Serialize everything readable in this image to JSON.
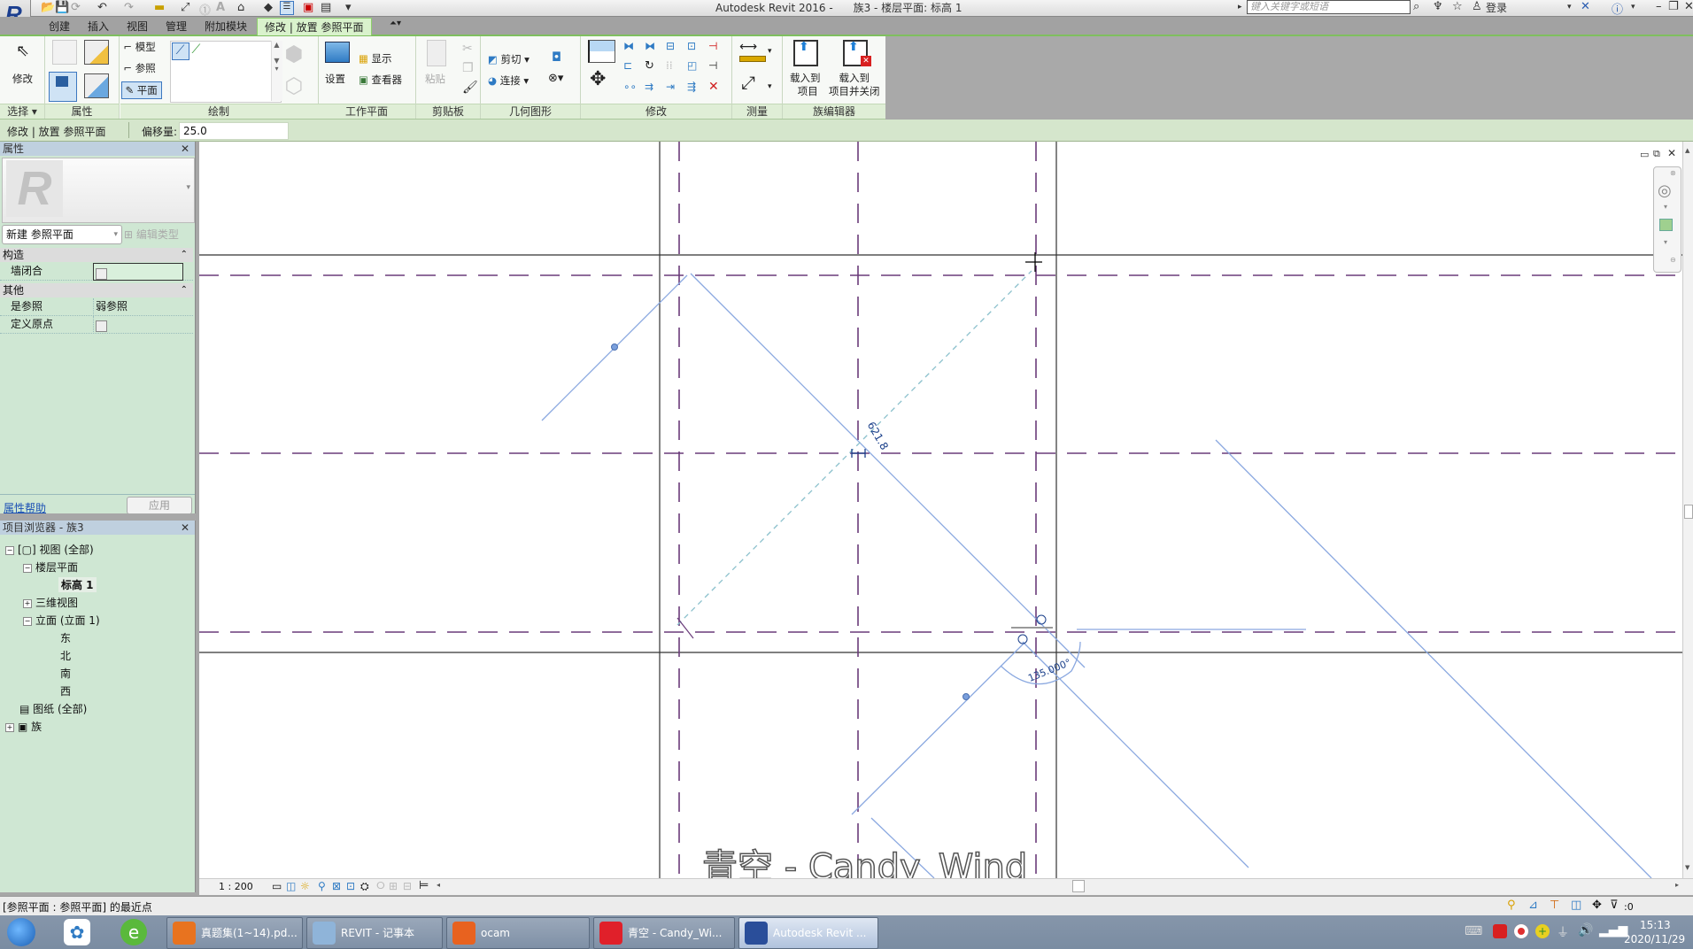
{
  "titlebar": {
    "title": "Autodesk Revit 2016 -      族3 - 楼层平面: 标高 1",
    "search_placeholder": "键入关键字或短语",
    "login": "登录"
  },
  "tabs": [
    {
      "label": "创建"
    },
    {
      "label": "插入"
    },
    {
      "label": "视图"
    },
    {
      "label": "管理"
    },
    {
      "label": "附加模块"
    },
    {
      "label": "修改 | 放置 参照平面",
      "active": true
    }
  ],
  "ribbon": {
    "select": {
      "modify": "修改",
      "label": "选择 ▾"
    },
    "properties": {
      "label": "属性"
    },
    "draw": {
      "model": "模型",
      "reference": "参照",
      "plane": "平面",
      "label": "绘制"
    },
    "workplane": {
      "set": "设置",
      "show": "显示",
      "viewer": "查看器",
      "label": "工作平面"
    },
    "clipboard": {
      "paste": "粘贴",
      "label": "剪贴板"
    },
    "geometry": {
      "cut": "剪切",
      "join": "连接",
      "label": "几何图形"
    },
    "modify": {
      "label": "修改"
    },
    "measure": {
      "label": "测量"
    },
    "family_editor": {
      "load_project": "载入到\n项目",
      "load_project_l1": "载入到",
      "load_project_l2": "项目",
      "load_close_l1": "载入到",
      "load_close_l2": "项目并关闭",
      "label": "族编辑器"
    }
  },
  "options_bar": {
    "context": "修改 | 放置 参照平面",
    "offset_label": "偏移量:",
    "offset_value": "25.0"
  },
  "properties": {
    "title": "属性",
    "type_selector": "新建 参照平面",
    "edit_type": "编辑类型",
    "groups": [
      {
        "name": "构造",
        "rows": [
          {
            "key": "墙闭合",
            "value": "",
            "checkbox": true
          }
        ]
      },
      {
        "name": "其他",
        "rows": [
          {
            "key": "是参照",
            "value": "弱参照"
          },
          {
            "key": "定义原点",
            "value": "",
            "checkbox": true
          }
        ]
      }
    ],
    "help_link": "属性帮助",
    "apply": "应用"
  },
  "browser": {
    "title": "项目浏览器 - 族3",
    "nodes": [
      {
        "label": "视图 (全部)",
        "pm": "−"
      },
      {
        "label": "楼层平面",
        "pm": "−"
      },
      {
        "label": "标高 1",
        "bold": true
      },
      {
        "label": "三维视图",
        "pm": "+"
      },
      {
        "label": "立面 (立面 1)",
        "pm": "−"
      },
      {
        "label": "东"
      },
      {
        "label": "北"
      },
      {
        "label": "南"
      },
      {
        "label": "西"
      },
      {
        "label": "图纸 (全部)"
      },
      {
        "label": "族",
        "pm": "+"
      }
    ]
  },
  "canvas": {
    "dimension_text": "621.8",
    "angle_text": "135.000°",
    "watermark": "青空 - Candy_Wind"
  },
  "viewbar": {
    "scale": "1 : 200"
  },
  "statusbar": {
    "text": "[参照平面 : 参照平面] 的最近点",
    "filter_count": ":0"
  },
  "taskbar": {
    "items": [
      {
        "label": "真题集(1~14).pd...",
        "color": "#e8731f"
      },
      {
        "label": "REVIT - 记事本",
        "color": "#8fb4d9"
      },
      {
        "label": "ocam",
        "color": "#e8621f"
      },
      {
        "label": "青空 - Candy_Wi...",
        "color": "#e0202a"
      },
      {
        "label": "Autodesk Revit ...",
        "color": "#2a4e9a",
        "active": true
      }
    ],
    "time": "15:13",
    "date": "2020/11/29"
  },
  "colors": {
    "ribbon_accent": "#7fbf5f",
    "palette_bg": "#cfe7d3",
    "ref_plane": "#6a3b7a",
    "sketch_line": "#8aa8e0",
    "dimension": "#1a3f8a"
  }
}
